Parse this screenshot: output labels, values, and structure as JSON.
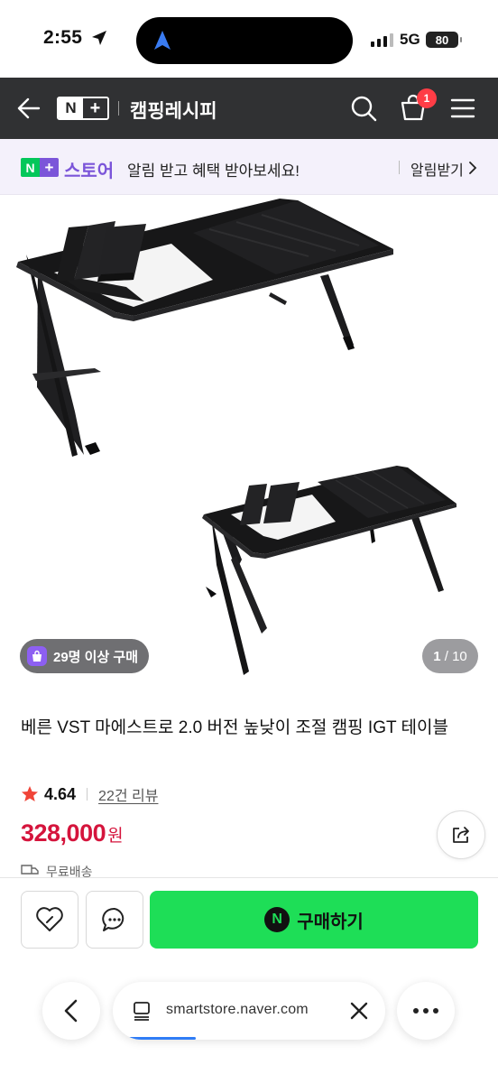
{
  "status_bar": {
    "time": "2:55",
    "network": "5G",
    "battery": "80"
  },
  "header": {
    "store_name": "캠핑레시피",
    "cart_count": "1"
  },
  "banner": {
    "brand": "스토어",
    "message": "알림 받고 혜택 받아보세요!",
    "cta": "알림받기"
  },
  "gallery": {
    "purchase_badge": "29명 이상 구매",
    "current_page": "1",
    "total_pages": "10"
  },
  "product": {
    "title": "베른 VST 마에스트로 2.0 버전 높낮이 조절 캠핑 IGT 테이블",
    "rating": "4.64",
    "review_link": "22건 리뷰",
    "price": "328,000",
    "currency": "원",
    "shipping": "무료배송"
  },
  "actions": {
    "buy_label": "구매하기"
  },
  "browser": {
    "url": "smartstore.naver.com"
  },
  "colors": {
    "header_bg": "#303133",
    "price": "#d5143c",
    "buy_button": "#1ede57",
    "banner_brand": "#7b55d9"
  }
}
